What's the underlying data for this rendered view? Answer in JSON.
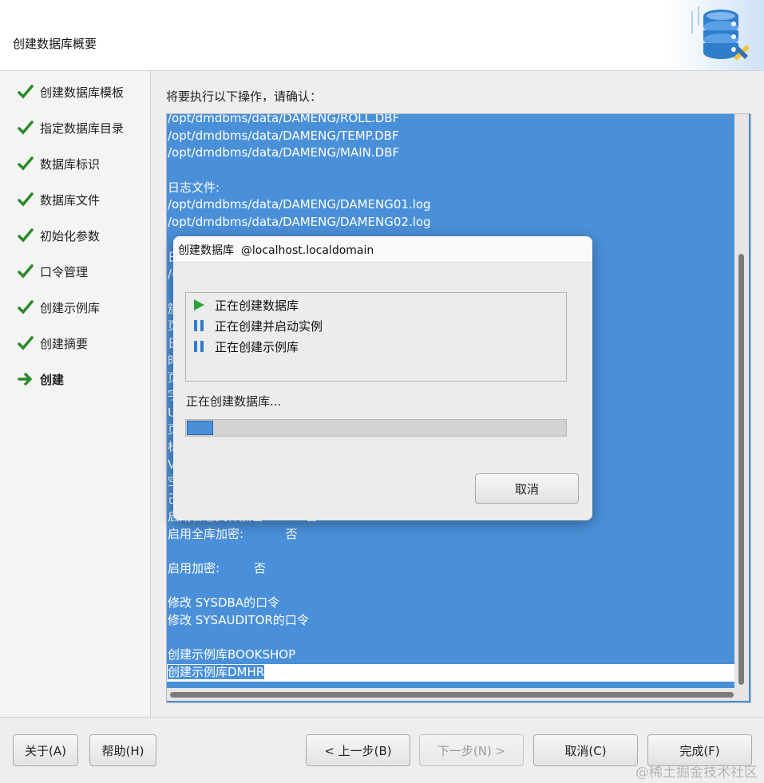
{
  "window": {
    "header_title": "创建数据库概要"
  },
  "sidebar": {
    "items": [
      {
        "label": "创建数据库模板",
        "state": "done"
      },
      {
        "label": "指定数据库目录",
        "state": "done"
      },
      {
        "label": "数据库标识",
        "state": "done"
      },
      {
        "label": "数据库文件",
        "state": "done"
      },
      {
        "label": "初始化参数",
        "state": "done"
      },
      {
        "label": "口令管理",
        "state": "done"
      },
      {
        "label": "创建示例库",
        "state": "done"
      },
      {
        "label": "创建摘要",
        "state": "done"
      },
      {
        "label": "创建",
        "state": "current"
      }
    ]
  },
  "main": {
    "confirm_label": "将要执行以下操作，请确认：",
    "summary_lines": [
      "/opt/dmdbms/data/DAMENG/ROLL.DBF",
      "/opt/dmdbms/data/DAMENG/TEMP.DBF",
      "/opt/dmdbms/data/DAMENG/MAIN.DBF",
      "",
      "日志文件:",
      "/opt/dmdbms/data/DAMENG/DAMENG01.log",
      "/opt/dmdbms/data/DAMENG/DAMENG02.log",
      "",
      "日",
      "/(",
      "",
      "簇",
      "页",
      "日",
      "时",
      "页",
      "字",
      "U",
      "页",
      "标",
      "V",
      "空",
      "己",
      "启用日志文件加密:          否",
      "启用全库加密:           否",
      "",
      "启用加密:         否",
      "",
      "修改 SYSDBA的口令",
      "修改 SYSAUDITOR的口令",
      "",
      "创建示例库BOOKSHOP",
      "创建示例库DMHR"
    ]
  },
  "dialog": {
    "title": "创建数据库  @localhost.localdomain",
    "tasks": [
      {
        "label": "正在创建数据库",
        "icon": "play-icon",
        "color": "#2aa33c"
      },
      {
        "label": "正在创建并启动实例",
        "icon": "pause-icon",
        "color": "#2f7dcc"
      },
      {
        "label": "正在创建示例库",
        "icon": "pause-icon",
        "color": "#2f7dcc"
      }
    ],
    "status_text": "正在创建数据库...",
    "progress": 0.07,
    "cancel_label": "取消"
  },
  "footer": {
    "about_label": "关于(A)",
    "help_label": "帮助(H)",
    "prev_label": "< 上一步(B)",
    "next_label": "下一步(N) >",
    "cancel_label": "取消(C)",
    "finish_label": "完成(F)"
  },
  "watermark": "@稀土掘金技术社区",
  "colors": {
    "selection_blue": "#4a90d9",
    "check_green": "#2a8a2a",
    "play_green": "#2aa33c",
    "pause_blue": "#2f7dcc"
  }
}
